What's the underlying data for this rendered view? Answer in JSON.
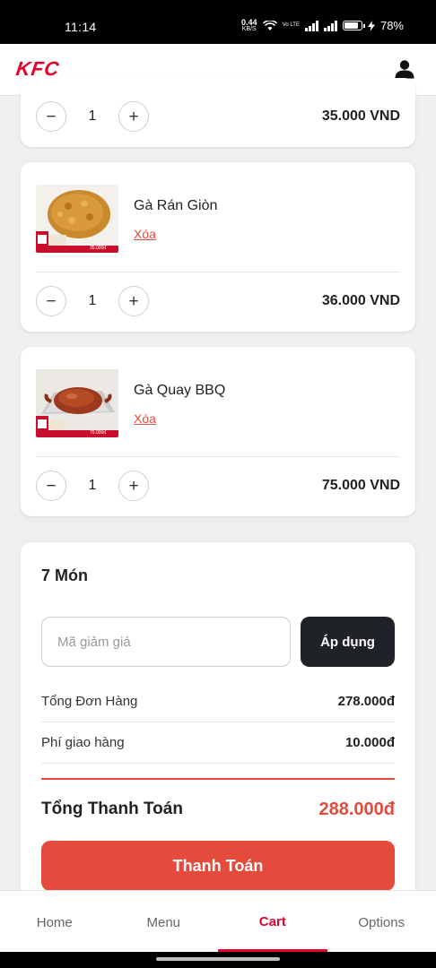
{
  "status_bar": {
    "time": "11:14",
    "net_speed_value": "0.44",
    "net_speed_unit": "KB/S",
    "volte": "Vo LTE",
    "battery": "78%"
  },
  "header": {
    "logo": "KFC",
    "accent_color": "#e4002b"
  },
  "cart_items": [
    {
      "quantity": "1",
      "price": "35.000 VND"
    },
    {
      "name": "Gà Rán Giòn",
      "remove_label": "Xóa",
      "quantity": "1",
      "price": "36.000 VND",
      "image": "fried-chicken-photo"
    },
    {
      "name": "Gà Quay BBQ",
      "remove_label": "Xóa",
      "quantity": "1",
      "price": "75.000 VND",
      "image": "bbq-chicken-photo"
    }
  ],
  "summary": {
    "item_count": "7 Món",
    "promo_placeholder": "Mã giảm giá",
    "apply_label": "Áp dụng",
    "subtotal_label": "Tổng Đơn Hàng",
    "subtotal_value": "278.000đ",
    "shipping_label": "Phí giao hàng",
    "shipping_value": "10.000đ",
    "total_label": "Tổng Thanh Toán",
    "total_value": "288.000đ",
    "checkout_label": "Thanh Toán",
    "checkout_color": "#e54b3c"
  },
  "bottom_nav": {
    "items": [
      {
        "label": "Home"
      },
      {
        "label": "Menu"
      },
      {
        "label": "Cart"
      },
      {
        "label": "Options"
      }
    ],
    "active": "Cart"
  }
}
